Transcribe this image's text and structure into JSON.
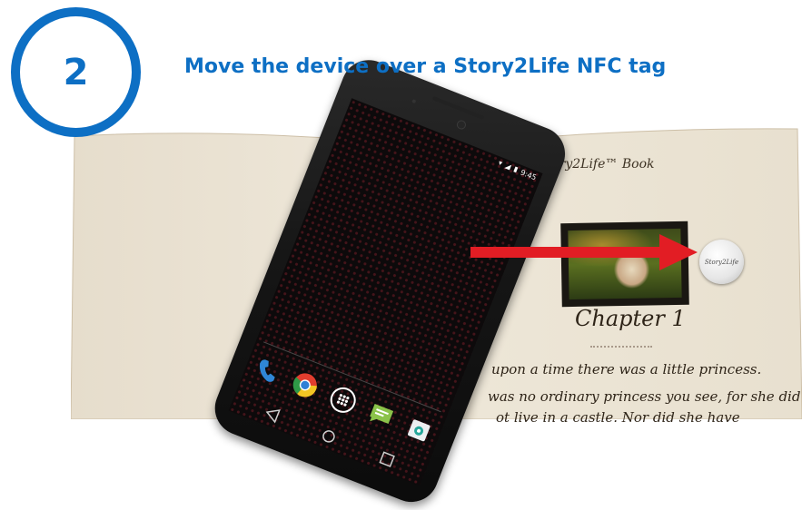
{
  "step": {
    "number": "2"
  },
  "headline": "Move the device over a Story2Life NFC tag",
  "book": {
    "title": "Story2Life™ Book",
    "chapter": "Chapter 1",
    "lines": [
      "upon a time there was a little princess.",
      "was no ordinary princess you see, for she did",
      "ot live in a castle. Nor did she have"
    ]
  },
  "nfc_tag": {
    "label": "Story2Life"
  },
  "phone": {
    "time": "9:45"
  },
  "dock_icons": [
    "phone-icon",
    "chrome-icon",
    "app-drawer-icon",
    "messaging-icon",
    "camera-icon"
  ],
  "colors": {
    "accent": "#0d6fc4",
    "arrow": "#e21d24"
  }
}
